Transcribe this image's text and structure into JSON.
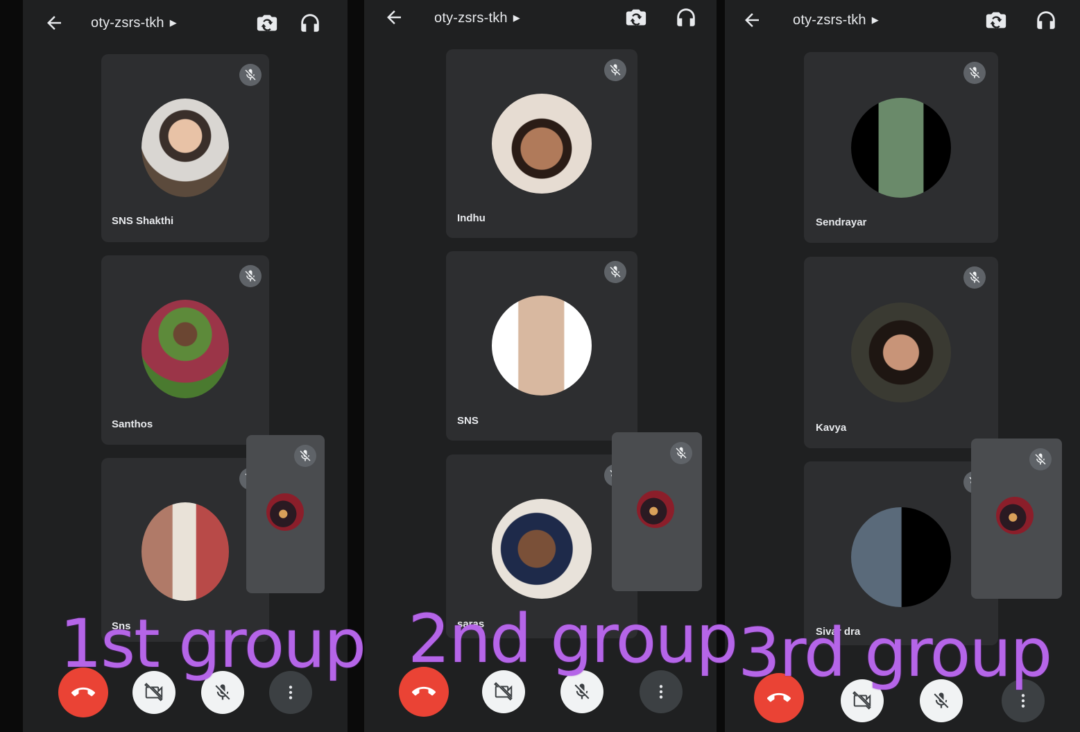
{
  "colors": {
    "panel_bg": "#1f2021",
    "tile_bg": "#2d2e30",
    "end_call": "#ea4335",
    "label_purple": "#b565e8"
  },
  "panels": [
    {
      "meeting_code": "oty-zsrs-tkh",
      "participants": [
        {
          "name": "SNS Shakthi"
        },
        {
          "name": "Santhos"
        },
        {
          "name": "Sns"
        }
      ],
      "group_label": "1st group"
    },
    {
      "meeting_code": "oty-zsrs-tkh",
      "participants": [
        {
          "name": "Indhu"
        },
        {
          "name": "SNS"
        },
        {
          "name": "saras"
        }
      ],
      "group_label": "2nd group"
    },
    {
      "meeting_code": "oty-zsrs-tkh",
      "participants": [
        {
          "name": "Sendrayar"
        },
        {
          "name": "Kavya"
        },
        {
          "name": "Sivar dra"
        }
      ],
      "group_label": "3rd group"
    }
  ],
  "icons": {
    "back": "arrow-left-icon",
    "switch_camera": "switch-camera-icon",
    "audio_output": "headphones-icon",
    "muted": "mic-off-icon",
    "end_call": "phone-hangup-icon",
    "camera_off": "video-off-icon",
    "more": "more-vert-icon"
  }
}
